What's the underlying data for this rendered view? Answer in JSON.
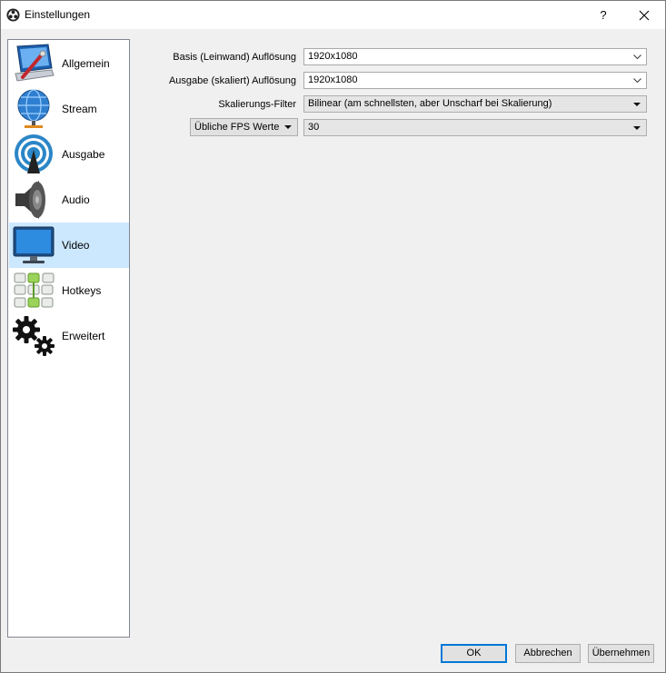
{
  "window": {
    "title": "Einstellungen",
    "help_label": "?"
  },
  "sidebar": {
    "items": [
      {
        "label": "Allgemein",
        "icon": "general-icon",
        "selected": false
      },
      {
        "label": "Stream",
        "icon": "stream-globe-icon",
        "selected": false
      },
      {
        "label": "Ausgabe",
        "icon": "output-broadcast-icon",
        "selected": false
      },
      {
        "label": "Audio",
        "icon": "speaker-icon",
        "selected": false
      },
      {
        "label": "Video",
        "icon": "monitor-icon",
        "selected": true
      },
      {
        "label": "Hotkeys",
        "icon": "keyboard-icon",
        "selected": false
      },
      {
        "label": "Erweitert",
        "icon": "gears-icon",
        "selected": false
      }
    ]
  },
  "video": {
    "base_resolution": {
      "label": "Basis (Leinwand) Auflösung",
      "value": "1920x1080"
    },
    "output_resolution": {
      "label": "Ausgabe (skaliert) Auflösung",
      "value": "1920x1080"
    },
    "scale_filter": {
      "label": "Skalierungs-Filter",
      "value": "Bilinear (am schnellsten, aber Unscharf bei Skalierung)"
    },
    "fps": {
      "type_label": "Übliche FPS Werte",
      "value": "30"
    }
  },
  "buttons": {
    "ok": "OK",
    "cancel": "Abbrechen",
    "apply": "Übernehmen"
  },
  "colors": {
    "selected_bg": "#cce8ff",
    "default_button_border": "#0078d7"
  }
}
